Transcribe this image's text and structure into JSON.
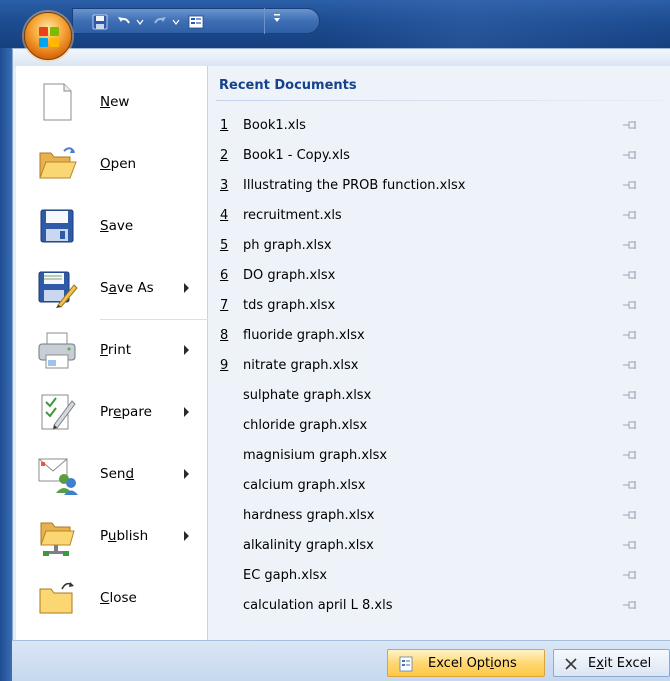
{
  "office_button": {
    "icon": "office-logo-icon"
  },
  "quick_access": {
    "items": [
      "save-icon",
      "undo-icon",
      "redo-icon",
      "form-icon",
      "customize-icon"
    ]
  },
  "menu": {
    "items": [
      {
        "id": "new",
        "label": "New",
        "mnemonic": "N",
        "icon": "new-document-icon",
        "has_submenu": false
      },
      {
        "id": "open",
        "label": "Open",
        "mnemonic": "O",
        "icon": "open-folder-icon",
        "has_submenu": false
      },
      {
        "id": "save",
        "label": "Save",
        "mnemonic": "S",
        "icon": "save-disk-icon",
        "has_submenu": false
      },
      {
        "id": "save-as",
        "label": "Save As",
        "mnemonic": "A",
        "icon": "save-as-icon",
        "has_submenu": true
      },
      {
        "id": "print",
        "label": "Print",
        "mnemonic": "P",
        "icon": "printer-icon",
        "has_submenu": true
      },
      {
        "id": "prepare",
        "label": "Prepare",
        "mnemonic": "E",
        "icon": "prepare-icon",
        "has_submenu": true
      },
      {
        "id": "send",
        "label": "Send",
        "mnemonic": "D",
        "icon": "send-icon",
        "has_submenu": true
      },
      {
        "id": "publish",
        "label": "Publish",
        "mnemonic": "U",
        "icon": "publish-icon",
        "has_submenu": true
      },
      {
        "id": "close",
        "label": "Close",
        "mnemonic": "C",
        "icon": "close-folder-icon",
        "has_submenu": false
      }
    ]
  },
  "recent": {
    "header": "Recent Documents",
    "items": [
      {
        "num": "1",
        "name": "Book1.xls"
      },
      {
        "num": "2",
        "name": "Book1 - Copy.xls"
      },
      {
        "num": "3",
        "name": "Illustrating the PROB function.xlsx"
      },
      {
        "num": "4",
        "name": "recruitment.xls"
      },
      {
        "num": "5",
        "name": "ph graph.xlsx"
      },
      {
        "num": "6",
        "name": "DO graph.xlsx"
      },
      {
        "num": "7",
        "name": "tds graph.xlsx"
      },
      {
        "num": "8",
        "name": "fluoride graph.xlsx"
      },
      {
        "num": "9",
        "name": "nitrate graph.xlsx"
      },
      {
        "num": "",
        "name": "sulphate graph.xlsx"
      },
      {
        "num": "",
        "name": "chloride graph.xlsx"
      },
      {
        "num": "",
        "name": "magnisium graph.xlsx"
      },
      {
        "num": "",
        "name": "calcium graph.xlsx"
      },
      {
        "num": "",
        "name": "hardness graph.xlsx"
      },
      {
        "num": "",
        "name": "alkalinity graph.xlsx"
      },
      {
        "num": "",
        "name": "EC gaph.xlsx"
      },
      {
        "num": "",
        "name": "calculation april L 8.xls"
      }
    ]
  },
  "footer": {
    "options_label": "Excel Options",
    "exit_label": "Exit Excel"
  },
  "colors": {
    "titlebar": "#1d4c91",
    "menu_bg": "#e3ecf7",
    "options_highlight": "#ffd874",
    "recent_header": "#15428b"
  }
}
